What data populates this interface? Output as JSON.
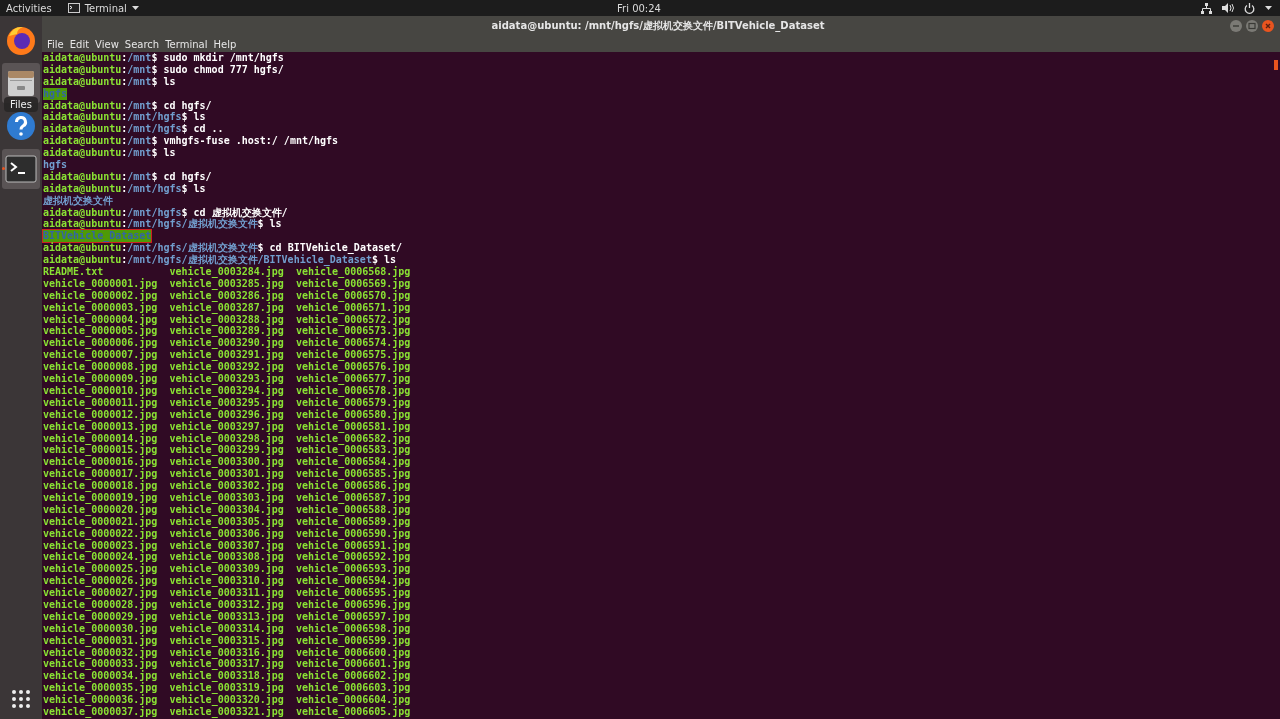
{
  "top_bar": {
    "activities": "Activities",
    "app_menu": "Terminal",
    "clock": "Fri 00:24"
  },
  "dock": {
    "items": [
      {
        "kind": "firefox",
        "hovered": false,
        "running": false
      },
      {
        "kind": "files",
        "hovered": true,
        "running": false
      },
      {
        "kind": "help",
        "hovered": false,
        "running": false
      },
      {
        "kind": "terminal",
        "hovered": true,
        "running": true
      }
    ],
    "tooltip": "Files"
  },
  "window": {
    "title": "aidata@ubuntu: /mnt/hgfs/虚拟机交换文件/BITVehicle_Dataset",
    "menu": [
      "File",
      "Edit",
      "View",
      "Search",
      "Terminal",
      "Help"
    ]
  },
  "terminal_lines": [
    {
      "kind": "prompt",
      "user": "aidata@ubuntu",
      "separator": ":",
      "path": "/mnt",
      "prompt_sign": "$",
      "command": "sudo mkdir /mnt/hgfs"
    },
    {
      "kind": "prompt",
      "user": "aidata@ubuntu",
      "separator": ":",
      "path": "/mnt",
      "prompt_sign": "$",
      "command": "sudo chmod 777 hgfs/"
    },
    {
      "kind": "prompt",
      "user": "aidata@ubuntu",
      "separator": ":",
      "path": "/mnt",
      "prompt_sign": "$",
      "command": "ls"
    },
    {
      "kind": "output",
      "text": "hgfs",
      "selected": true,
      "boxed": false
    },
    {
      "kind": "prompt",
      "user": "aidata@ubuntu",
      "separator": ":",
      "path": "/mnt",
      "prompt_sign": "$",
      "command": "cd hgfs/"
    },
    {
      "kind": "prompt",
      "user": "aidata@ubuntu",
      "separator": ":",
      "path": "/mnt/hgfs",
      "prompt_sign": "$",
      "command": "ls"
    },
    {
      "kind": "prompt",
      "user": "aidata@ubuntu",
      "separator": ":",
      "path": "/mnt/hgfs",
      "prompt_sign": "$",
      "command": "cd .."
    },
    {
      "kind": "prompt",
      "user": "aidata@ubuntu",
      "separator": ":",
      "path": "/mnt",
      "prompt_sign": "$",
      "command": "vmhgfs-fuse .host:/ /mnt/hgfs"
    },
    {
      "kind": "prompt",
      "user": "aidata@ubuntu",
      "separator": ":",
      "path": "/mnt",
      "prompt_sign": "$",
      "command": "ls"
    },
    {
      "kind": "output",
      "text": "hgfs",
      "selected": false,
      "boxed": false
    },
    {
      "kind": "prompt",
      "user": "aidata@ubuntu",
      "separator": ":",
      "path": "/mnt",
      "prompt_sign": "$",
      "command": "cd hgfs/"
    },
    {
      "kind": "prompt",
      "user": "aidata@ubuntu",
      "separator": ":",
      "path": "/mnt/hgfs",
      "prompt_sign": "$",
      "command": "ls"
    },
    {
      "kind": "output",
      "text": "虚拟机交换文件",
      "selected": false,
      "boxed": false
    },
    {
      "kind": "prompt",
      "user": "aidata@ubuntu",
      "separator": ":",
      "path": "/mnt/hgfs",
      "prompt_sign": "$",
      "command": "cd 虚拟机交换文件/"
    },
    {
      "kind": "prompt",
      "user": "aidata@ubuntu",
      "separator": ":",
      "path": "/mnt/hgfs/虚拟机交换文件",
      "prompt_sign": "$",
      "command": "ls"
    },
    {
      "kind": "output",
      "text": "BITVehicle_Dataset",
      "selected": true,
      "boxed": true
    },
    {
      "kind": "prompt",
      "user": "aidata@ubuntu",
      "separator": ":",
      "path": "/mnt/hgfs/虚拟机交换文件",
      "prompt_sign": "$",
      "command": "cd BITVehicle_Dataset/"
    },
    {
      "kind": "prompt",
      "user": "aidata@ubuntu",
      "separator": ":",
      "path": "/mnt/hgfs/虚拟机交换文件/BITVehicle_Dataset",
      "prompt_sign": "$",
      "command": "ls"
    },
    {
      "kind": "listing",
      "columns": [
        "README.txt",
        "vehicle_0003284.jpg",
        "vehicle_0006568.jpg"
      ]
    },
    {
      "kind": "listing",
      "columns": [
        "vehicle_0000001.jpg",
        "vehicle_0003285.jpg",
        "vehicle_0006569.jpg"
      ]
    },
    {
      "kind": "listing",
      "columns": [
        "vehicle_0000002.jpg",
        "vehicle_0003286.jpg",
        "vehicle_0006570.jpg"
      ]
    },
    {
      "kind": "listing",
      "columns": [
        "vehicle_0000003.jpg",
        "vehicle_0003287.jpg",
        "vehicle_0006571.jpg"
      ]
    },
    {
      "kind": "listing",
      "columns": [
        "vehicle_0000004.jpg",
        "vehicle_0003288.jpg",
        "vehicle_0006572.jpg"
      ]
    },
    {
      "kind": "listing",
      "columns": [
        "vehicle_0000005.jpg",
        "vehicle_0003289.jpg",
        "vehicle_0006573.jpg"
      ]
    },
    {
      "kind": "listing",
      "columns": [
        "vehicle_0000006.jpg",
        "vehicle_0003290.jpg",
        "vehicle_0006574.jpg"
      ]
    },
    {
      "kind": "listing",
      "columns": [
        "vehicle_0000007.jpg",
        "vehicle_0003291.jpg",
        "vehicle_0006575.jpg"
      ]
    },
    {
      "kind": "listing",
      "columns": [
        "vehicle_0000008.jpg",
        "vehicle_0003292.jpg",
        "vehicle_0006576.jpg"
      ]
    },
    {
      "kind": "listing",
      "columns": [
        "vehicle_0000009.jpg",
        "vehicle_0003293.jpg",
        "vehicle_0006577.jpg"
      ]
    },
    {
      "kind": "listing",
      "columns": [
        "vehicle_0000010.jpg",
        "vehicle_0003294.jpg",
        "vehicle_0006578.jpg"
      ]
    },
    {
      "kind": "listing",
      "columns": [
        "vehicle_0000011.jpg",
        "vehicle_0003295.jpg",
        "vehicle_0006579.jpg"
      ]
    },
    {
      "kind": "listing",
      "columns": [
        "vehicle_0000012.jpg",
        "vehicle_0003296.jpg",
        "vehicle_0006580.jpg"
      ]
    },
    {
      "kind": "listing",
      "columns": [
        "vehicle_0000013.jpg",
        "vehicle_0003297.jpg",
        "vehicle_0006581.jpg"
      ]
    },
    {
      "kind": "listing",
      "columns": [
        "vehicle_0000014.jpg",
        "vehicle_0003298.jpg",
        "vehicle_0006582.jpg"
      ]
    },
    {
      "kind": "listing",
      "columns": [
        "vehicle_0000015.jpg",
        "vehicle_0003299.jpg",
        "vehicle_0006583.jpg"
      ]
    },
    {
      "kind": "listing",
      "columns": [
        "vehicle_0000016.jpg",
        "vehicle_0003300.jpg",
        "vehicle_0006584.jpg"
      ]
    },
    {
      "kind": "listing",
      "columns": [
        "vehicle_0000017.jpg",
        "vehicle_0003301.jpg",
        "vehicle_0006585.jpg"
      ]
    },
    {
      "kind": "listing",
      "columns": [
        "vehicle_0000018.jpg",
        "vehicle_0003302.jpg",
        "vehicle_0006586.jpg"
      ]
    },
    {
      "kind": "listing",
      "columns": [
        "vehicle_0000019.jpg",
        "vehicle_0003303.jpg",
        "vehicle_0006587.jpg"
      ]
    },
    {
      "kind": "listing",
      "columns": [
        "vehicle_0000020.jpg",
        "vehicle_0003304.jpg",
        "vehicle_0006588.jpg"
      ]
    },
    {
      "kind": "listing",
      "columns": [
        "vehicle_0000021.jpg",
        "vehicle_0003305.jpg",
        "vehicle_0006589.jpg"
      ]
    },
    {
      "kind": "listing",
      "columns": [
        "vehicle_0000022.jpg",
        "vehicle_0003306.jpg",
        "vehicle_0006590.jpg"
      ]
    },
    {
      "kind": "listing",
      "columns": [
        "vehicle_0000023.jpg",
        "vehicle_0003307.jpg",
        "vehicle_0006591.jpg"
      ]
    },
    {
      "kind": "listing",
      "columns": [
        "vehicle_0000024.jpg",
        "vehicle_0003308.jpg",
        "vehicle_0006592.jpg"
      ]
    },
    {
      "kind": "listing",
      "columns": [
        "vehicle_0000025.jpg",
        "vehicle_0003309.jpg",
        "vehicle_0006593.jpg"
      ]
    },
    {
      "kind": "listing",
      "columns": [
        "vehicle_0000026.jpg",
        "vehicle_0003310.jpg",
        "vehicle_0006594.jpg"
      ]
    },
    {
      "kind": "listing",
      "columns": [
        "vehicle_0000027.jpg",
        "vehicle_0003311.jpg",
        "vehicle_0006595.jpg"
      ]
    },
    {
      "kind": "listing",
      "columns": [
        "vehicle_0000028.jpg",
        "vehicle_0003312.jpg",
        "vehicle_0006596.jpg"
      ]
    },
    {
      "kind": "listing",
      "columns": [
        "vehicle_0000029.jpg",
        "vehicle_0003313.jpg",
        "vehicle_0006597.jpg"
      ]
    },
    {
      "kind": "listing",
      "columns": [
        "vehicle_0000030.jpg",
        "vehicle_0003314.jpg",
        "vehicle_0006598.jpg"
      ]
    },
    {
      "kind": "listing",
      "columns": [
        "vehicle_0000031.jpg",
        "vehicle_0003315.jpg",
        "vehicle_0006599.jpg"
      ]
    },
    {
      "kind": "listing",
      "columns": [
        "vehicle_0000032.jpg",
        "vehicle_0003316.jpg",
        "vehicle_0006600.jpg"
      ]
    },
    {
      "kind": "listing",
      "columns": [
        "vehicle_0000033.jpg",
        "vehicle_0003317.jpg",
        "vehicle_0006601.jpg"
      ]
    },
    {
      "kind": "listing",
      "columns": [
        "vehicle_0000034.jpg",
        "vehicle_0003318.jpg",
        "vehicle_0006602.jpg"
      ]
    },
    {
      "kind": "listing",
      "columns": [
        "vehicle_0000035.jpg",
        "vehicle_0003319.jpg",
        "vehicle_0006603.jpg"
      ]
    },
    {
      "kind": "listing",
      "columns": [
        "vehicle_0000036.jpg",
        "vehicle_0003320.jpg",
        "vehicle_0006604.jpg"
      ]
    },
    {
      "kind": "listing",
      "columns": [
        "vehicle_0000037.jpg",
        "vehicle_0003321.jpg",
        "vehicle_0006605.jpg"
      ]
    }
  ]
}
